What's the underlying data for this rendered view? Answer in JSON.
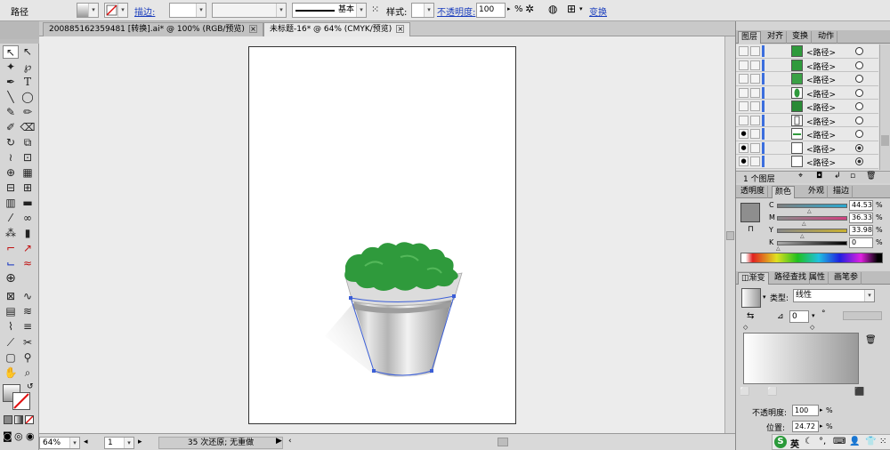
{
  "control_bar": {
    "object_type": "路径",
    "stroke_label": "描边:",
    "stroke_profile": "基本",
    "style_label": "样式:",
    "opacity_label": "不透明度:",
    "opacity_value": "100",
    "opacity_unit": "%",
    "transform_label": "变换"
  },
  "tabs": [
    {
      "label": "200885162359481 [转换].ai* @ 100% (RGB/预览)"
    },
    {
      "label": "未标题-16* @ 64% (CMYK/预览)"
    }
  ],
  "status": {
    "zoom": "64%",
    "page": "1",
    "history": "35 次还原; 无重做"
  },
  "layers_panel": {
    "tabs": [
      "图层",
      "对齐",
      "变换",
      "动作"
    ],
    "rows": [
      {
        "name": "<路径>",
        "visible": false,
        "thumb": "green",
        "target": "empty"
      },
      {
        "name": "<路径>",
        "visible": false,
        "thumb": "green",
        "target": "empty"
      },
      {
        "name": "<路径>",
        "visible": false,
        "thumb": "green",
        "target": "empty"
      },
      {
        "name": "<路径>",
        "visible": false,
        "thumb": "green-leaf",
        "target": "empty"
      },
      {
        "name": "<路径>",
        "visible": false,
        "thumb": "green-dark",
        "target": "empty"
      },
      {
        "name": "<路径>",
        "visible": false,
        "thumb": "outline",
        "target": "empty"
      },
      {
        "name": "<路径>",
        "visible": true,
        "thumb": "green-line",
        "target": "empty"
      },
      {
        "name": "<路径>",
        "visible": true,
        "thumb": "white",
        "target": "filled"
      },
      {
        "name": "<路径>",
        "visible": true,
        "thumb": "white",
        "target": "filled"
      }
    ],
    "footer": "1 个图层"
  },
  "color_panel": {
    "tabs": [
      "透明度",
      "颜色",
      "外观",
      "描边"
    ],
    "channels": [
      {
        "label": "C",
        "value": "44.53",
        "fraction": 0.4453
      },
      {
        "label": "M",
        "value": "36.33",
        "fraction": 0.3633
      },
      {
        "label": "Y",
        "value": "33.98",
        "fraction": 0.3398
      },
      {
        "label": "K",
        "value": "0",
        "fraction": 0
      }
    ],
    "unit": "%",
    "swatch_color": "#8e8e8e"
  },
  "gradient_panel": {
    "tabs": [
      "渐变",
      "路径查找",
      "属性",
      "画笔参"
    ],
    "type_label": "类型:",
    "type_value": "线性",
    "angle_value": "0",
    "angle_unit": "°",
    "opacity_label": "不透明度:",
    "opacity_value": "100",
    "location_label": "位置:",
    "location_value": "24.72",
    "unit": "%"
  },
  "ime_bar": {
    "mode": "英"
  },
  "colors": {
    "accent": "#1a3dbd",
    "leaf_green": "#2f9a3c",
    "pot_gray": "#cfcfcf",
    "selection_blue": "#3b5ed6"
  }
}
